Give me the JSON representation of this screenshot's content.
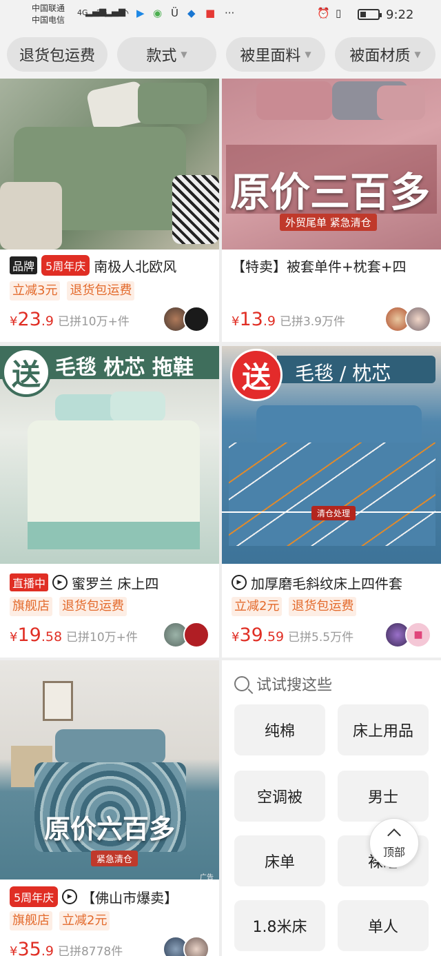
{
  "status_bar": {
    "carrier1": "中国联通",
    "carrier2": "中国电信",
    "net1": "4G",
    "net2": "2G",
    "time": "9:22",
    "icons": [
      "signal-icon",
      "wifi-icon",
      "app-icon",
      "alarm-icon",
      "vibrate-icon",
      "battery-icon"
    ]
  },
  "filters": [
    {
      "label": "退货包运费",
      "dropdown": false
    },
    {
      "label": "款式",
      "dropdown": true
    },
    {
      "label": "被里面料",
      "dropdown": true
    },
    {
      "label": "被面材质",
      "dropdown": true
    }
  ],
  "products": [
    {
      "badges": [
        "品牌",
        "5周年庆"
      ],
      "title": "南极人北欧风",
      "tags": [
        "立减3元",
        "退货包运费"
      ],
      "price_int": "23",
      "price_dec": ".9",
      "sold": "已拼10万+件",
      "currency": "¥"
    },
    {
      "title": "【特卖】被套单件+枕套+四",
      "overlay": "原价三百多",
      "strip": "外贸尾单  紧急清仓",
      "price_int": "13",
      "price_dec": ".9",
      "sold": "已拼3.9万件",
      "currency": "¥"
    },
    {
      "badges": [
        "直播中"
      ],
      "title": "蜜罗兰 床上四",
      "overlay_gift": "送",
      "overlay_banner": "毛毯 枕芯 拖鞋",
      "tags": [
        "旗舰店",
        "退货包运费"
      ],
      "price_int": "19",
      "price_dec": ".58",
      "sold": "已拼10万+件",
      "currency": "¥"
    },
    {
      "title": "加厚磨毛斜纹床上四件套",
      "overlay_gift": "送",
      "overlay_banner": "毛毯 / 枕芯",
      "strip": "清仓处理",
      "tags": [
        "立减2元",
        "退货包运费"
      ],
      "price_int": "39",
      "price_dec": ".59",
      "sold": "已拼5.5万件",
      "currency": "¥"
    },
    {
      "badges": [
        "5周年庆"
      ],
      "title": "【佛山市爆卖】",
      "overlay": "原价六百多",
      "strip": "紧急清仓",
      "ad": "广告",
      "tags": [
        "旗舰店",
        "立减2元"
      ],
      "price_int": "35",
      "price_dec": ".9",
      "sold": "已拼8778件",
      "currency": "¥"
    }
  ],
  "suggestions": {
    "header": "试试搜这些",
    "items": [
      "纯棉",
      "床上用品",
      "空调被",
      "男士",
      "床单",
      "裸睡",
      "1.8米床",
      "单人"
    ]
  },
  "back_to_top": "顶部",
  "colors": {
    "accent": "#e02e24",
    "tag_orange": "#e36a2c",
    "card_bg": "#ffffff",
    "page_bg": "#eeeeee"
  }
}
